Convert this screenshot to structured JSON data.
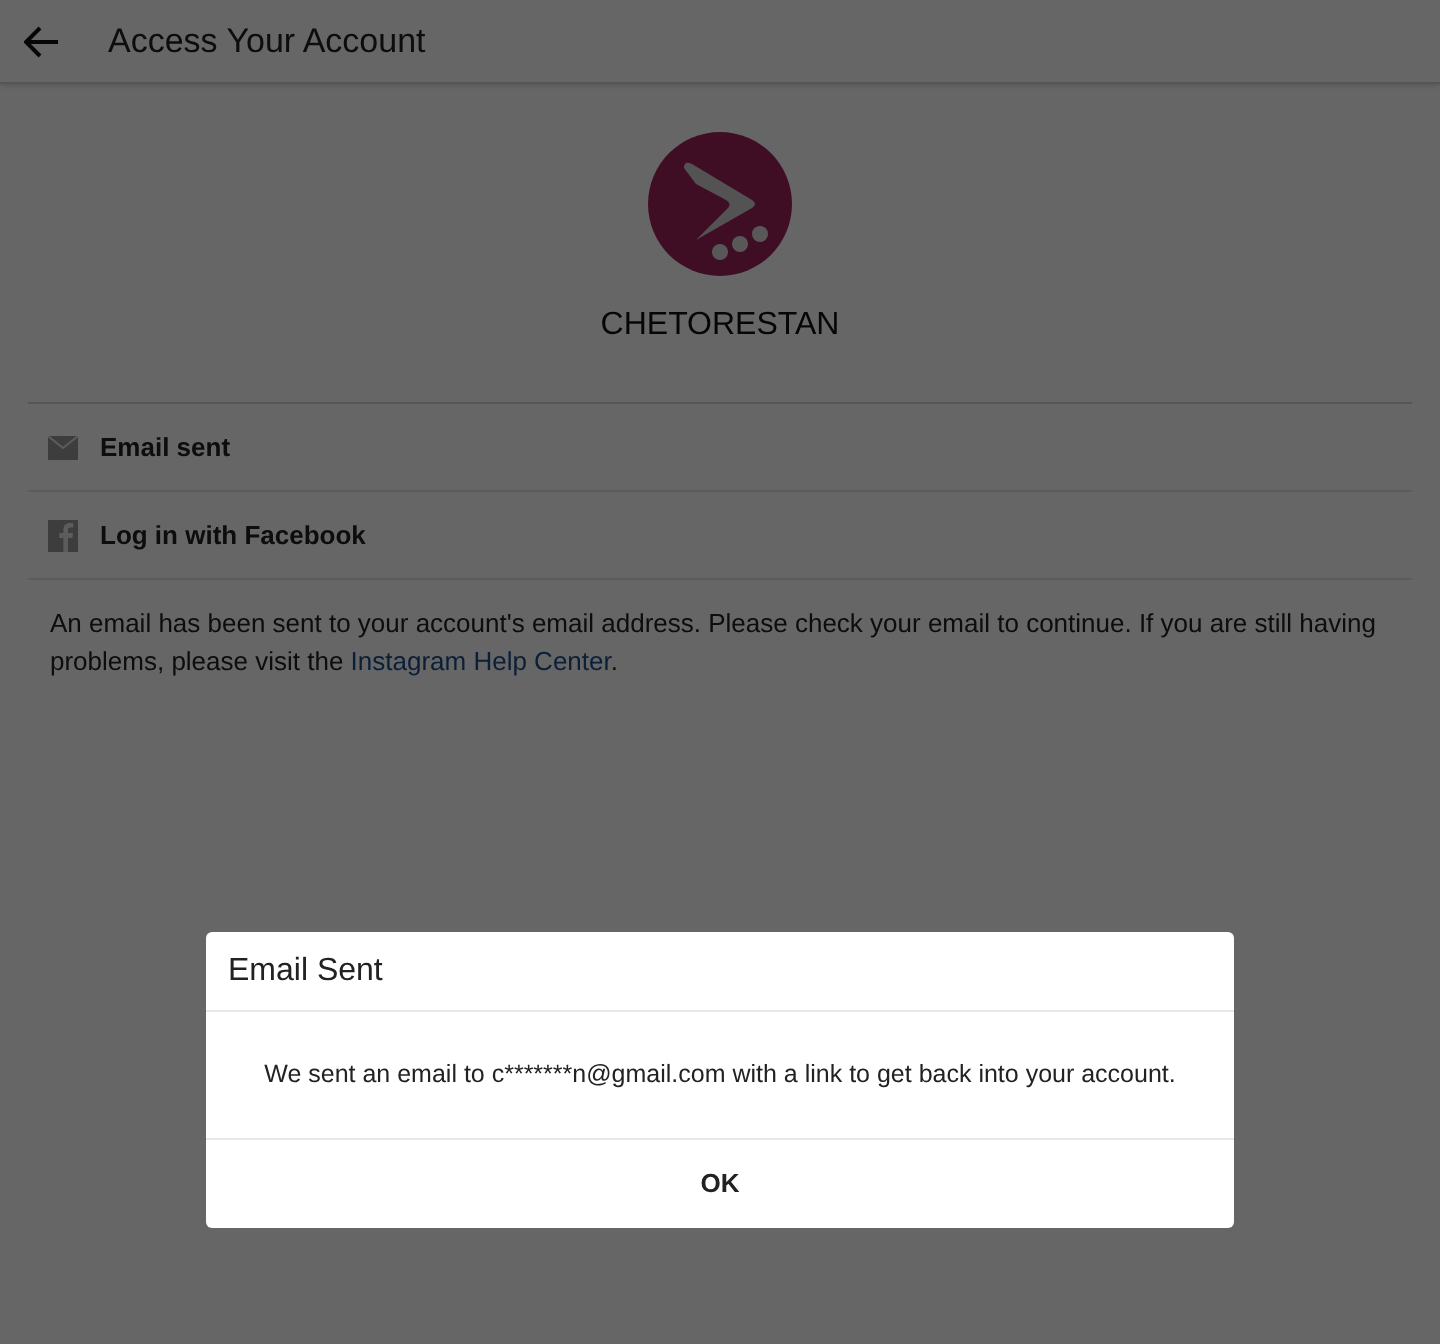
{
  "header": {
    "title": "Access Your Account"
  },
  "profile": {
    "username": "CHETORESTAN"
  },
  "options": [
    {
      "kind": "email",
      "label": "Email sent"
    },
    {
      "kind": "facebook",
      "label": "Log in with Facebook"
    }
  ],
  "message": {
    "text": "An email has been sent to your account's email address. Please check your email to continue. If you are still having problems, please visit the ",
    "link": "Instagram Help Center",
    "text_after": "."
  },
  "dialog": {
    "title": "Email Sent",
    "body": "We sent an email to c*******n@gmail.com with a link to get back into your account.",
    "button": "OK"
  }
}
